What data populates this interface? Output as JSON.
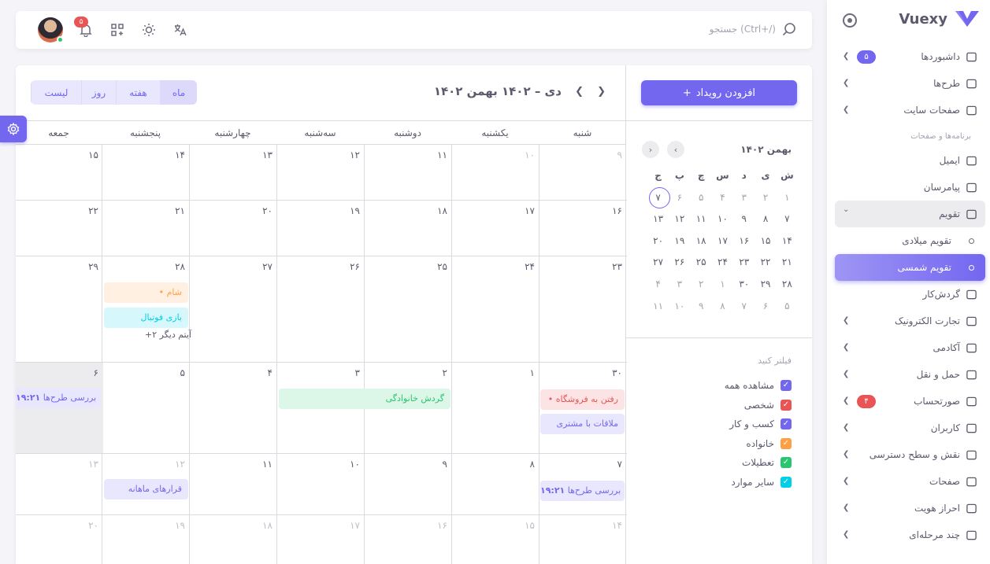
{
  "brand": {
    "name": "Vuexy"
  },
  "sidebar": {
    "items": [
      {
        "label": "داشبوردها",
        "badge": "۵",
        "badge_color": "#7367f0",
        "icon": "home-icon",
        "arrow": true
      },
      {
        "label": "طرح‌ها",
        "icon": "layout-icon",
        "arrow": true
      },
      {
        "label": "صفحات سایت",
        "icon": "files-icon",
        "arrow": true
      }
    ],
    "section_header": "برنامه‌ها و صفحات",
    "apps": [
      {
        "label": "ایمیل",
        "icon": "mail-icon"
      },
      {
        "label": "پیامرسان",
        "icon": "chat-icon"
      },
      {
        "label": "تقویم",
        "icon": "calendar-icon",
        "open": true
      },
      {
        "label": "تقویم میلادی",
        "sub": true
      },
      {
        "label": "تقویم شمسی",
        "sub": true,
        "active": true
      },
      {
        "label": "گردش‌کار",
        "icon": "kanban-icon"
      },
      {
        "label": "تجارت الکترونیک",
        "icon": "cart-icon",
        "arrow": true
      },
      {
        "label": "آکادمی",
        "icon": "book-icon",
        "arrow": true
      },
      {
        "label": "حمل و نقل",
        "icon": "truck-icon",
        "arrow": true
      },
      {
        "label": "صورتحساب",
        "icon": "invoice-icon",
        "arrow": true,
        "badge": "۴",
        "badge_color": "#ea5455"
      },
      {
        "label": "کاربران",
        "icon": "users-icon",
        "arrow": true
      },
      {
        "label": "نقش و سطح دسترسی",
        "icon": "settings-icon",
        "arrow": true
      },
      {
        "label": "صفحات",
        "icon": "file-icon",
        "arrow": true
      },
      {
        "label": "احراز هویت",
        "icon": "lock-icon",
        "arrow": true
      },
      {
        "label": "چند مرحله‌ای",
        "icon": "forms-icon",
        "arrow": true
      }
    ]
  },
  "navbar": {
    "search_placeholder": "جستجو (Ctrl+/)",
    "notif_count": "۵"
  },
  "calendar": {
    "add_event": "افزودن رویداد",
    "title": "۱۴۰۲ دی – ۱۴۰۲ بهمن",
    "views": [
      "ماه",
      "هفته",
      "روز",
      "لیست"
    ],
    "weekdays": [
      "شنبه",
      "یکشنبه",
      "دوشنبه",
      "سه‌شنبه",
      "چهارشنبه",
      "پنجشنبه",
      "جمعه"
    ],
    "weeks": [
      [
        "۹",
        "۱۰",
        "۱۱",
        "۱۲",
        "۱۳",
        "۱۴",
        "۱۵"
      ],
      [
        "۱۶",
        "۱۷",
        "۱۸",
        "۱۹",
        "۲۰",
        "۲۱",
        "۲۲"
      ],
      [
        "۲۳",
        "۲۴",
        "۲۵",
        "۲۶",
        "۲۷",
        "۲۸",
        "۲۹"
      ],
      [
        "۳۰",
        "۱",
        "۲",
        "۳",
        "۴",
        "۵",
        "۶"
      ],
      [
        "۷",
        "۸",
        "۹",
        "۱۰",
        "۱۱",
        "۱۲",
        "۱۳"
      ],
      [
        "۱۴",
        "۱۵",
        "۱۶",
        "۱۷",
        "۱۸",
        "۱۹",
        "۲۰"
      ]
    ],
    "events": {
      "dinner": "• شام",
      "football": "بازی فوتبال",
      "more": "+۲ آیتم دیگر",
      "shopping": "• رفتن به فروشگاه",
      "customer": "ملاقات با مشتری",
      "family_trip": "گردش خانوادگی",
      "review1_time": "۱۹:۲۱",
      "review1": "بررسی طرح‌ها",
      "review2_time": "۱۹:۲۱",
      "review2": "بررسی طرح‌ها",
      "monthly": "قرارهای ماهانه"
    },
    "colors": {
      "primary": "#7367f0",
      "danger": "#ea5455",
      "warning": "#ff9f43",
      "success": "#28c76f",
      "info": "#00cfe8"
    }
  },
  "mini_calendar": {
    "title": "بهمن ۱۴۰۲",
    "weekdays": [
      "ش",
      "ی",
      "د",
      "س",
      "چ",
      "پ",
      "ج"
    ],
    "weeks": [
      [
        "۱",
        "۲",
        "۳",
        "۴",
        "۵",
        "۶",
        "۷"
      ],
      [
        "۷",
        "۸",
        "۹",
        "۱۰",
        "۱۱",
        "۱۲",
        "۱۳"
      ],
      [
        "۱۴",
        "۱۵",
        "۱۶",
        "۱۷",
        "۱۸",
        "۱۹",
        "۲۰"
      ],
      [
        "۲۱",
        "۲۲",
        "۲۳",
        "۲۴",
        "۲۵",
        "۲۶",
        "۲۷"
      ],
      [
        "۲۸",
        "۲۹",
        "۳۰",
        "۱",
        "۲",
        "۳",
        "۴"
      ],
      [
        "۵",
        "۶",
        "۷",
        "۸",
        "۹",
        "۱۰",
        "۱۱"
      ]
    ]
  },
  "filters": {
    "title": "فیلتر کنید",
    "items": [
      {
        "label": "مشاهده همه",
        "color": "#7367f0"
      },
      {
        "label": "شخصی",
        "color": "#ea5455"
      },
      {
        "label": "کسب و کار",
        "color": "#7367f0"
      },
      {
        "label": "خانواده",
        "color": "#ff9f43"
      },
      {
        "label": "تعطیلات",
        "color": "#28c76f"
      },
      {
        "label": "سایر موارد",
        "color": "#00cfe8"
      }
    ]
  }
}
